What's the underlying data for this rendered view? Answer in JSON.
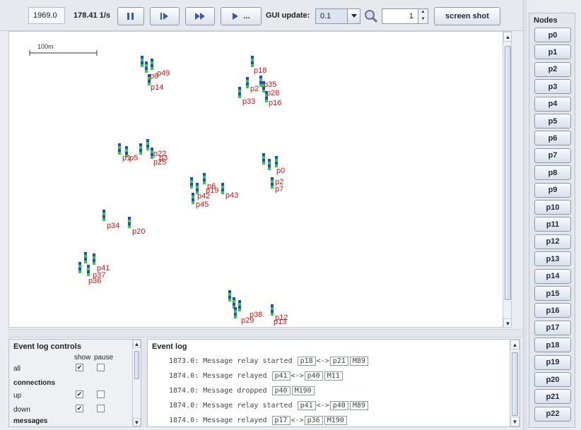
{
  "toolbar": {
    "sim_time": "1969.0",
    "speed": "178.41 1/s",
    "gui_update_label": "GUI update:",
    "gui_update_value": "0.1",
    "zoom_value": "1",
    "screenshot_label": "screen shot",
    "fast_forward_label": "..."
  },
  "world": {
    "scale_label": "100m",
    "nodes": [
      {
        "label": "p49"
      },
      {
        "label": "p8"
      },
      {
        "label": "p14"
      },
      {
        "label": "p18"
      },
      {
        "label": "p2"
      },
      {
        "label": "p35"
      },
      {
        "label": "p28"
      },
      {
        "label": "p33"
      },
      {
        "label": "p16"
      },
      {
        "label": "p1"
      },
      {
        "label": "p5"
      },
      {
        "label": "p22"
      },
      {
        "label": "p3"
      },
      {
        "label": "p25"
      },
      {
        "label": "p0"
      },
      {
        "label": "p2"
      },
      {
        "label": "p7"
      },
      {
        "label": "p6"
      },
      {
        "label": "p19"
      },
      {
        "label": "p42"
      },
      {
        "label": "p45"
      },
      {
        "label": "p43"
      },
      {
        "label": "p34"
      },
      {
        "label": "p20"
      },
      {
        "label": "p41"
      },
      {
        "label": "p37"
      },
      {
        "label": "p36"
      },
      {
        "label": "p38"
      },
      {
        "label": "p29"
      },
      {
        "label": "p12"
      },
      {
        "label": "p13"
      }
    ]
  },
  "event_log_controls": {
    "title": "Event log controls",
    "col_show": "show",
    "col_pause": "pause",
    "rows": [
      {
        "label": "all",
        "show": "✔",
        "pause": ""
      },
      {
        "label": "connections",
        "header": true
      },
      {
        "label": "up",
        "show": "✔",
        "pause": ""
      },
      {
        "label": "down",
        "show": "✔",
        "pause": ""
      },
      {
        "label": "messages",
        "header": true
      }
    ]
  },
  "event_log": {
    "title": "Event log",
    "lines": [
      {
        "text": "1873.0: Message relay started",
        "a": "p18",
        "sep": "<->",
        "b": "p21",
        "msg": "M89"
      },
      {
        "text": "1874.0: Message relayed",
        "a": "p41",
        "sep": "<->",
        "b": "p40",
        "msg": "M11"
      },
      {
        "text": "1874.0: Message dropped",
        "a": "p40",
        "sep": "",
        "b": "",
        "msg": "M190"
      },
      {
        "text": "1874.0: Message relay started",
        "a": "p41",
        "sep": "<->",
        "b": "p40",
        "msg": "M89"
      },
      {
        "text": "1874.0: Message relayed",
        "a": "p17",
        "sep": "<->",
        "b": "p36",
        "msg": "M190"
      }
    ]
  },
  "nodes_panel": {
    "title": "Nodes",
    "items": [
      "p0",
      "p1",
      "p2",
      "p3",
      "p4",
      "p5",
      "p6",
      "p7",
      "p8",
      "p9",
      "p10",
      "p11",
      "p12",
      "p13",
      "p14",
      "p15",
      "p16",
      "p17",
      "p18",
      "p19",
      "p20",
      "p21",
      "p22"
    ]
  }
}
